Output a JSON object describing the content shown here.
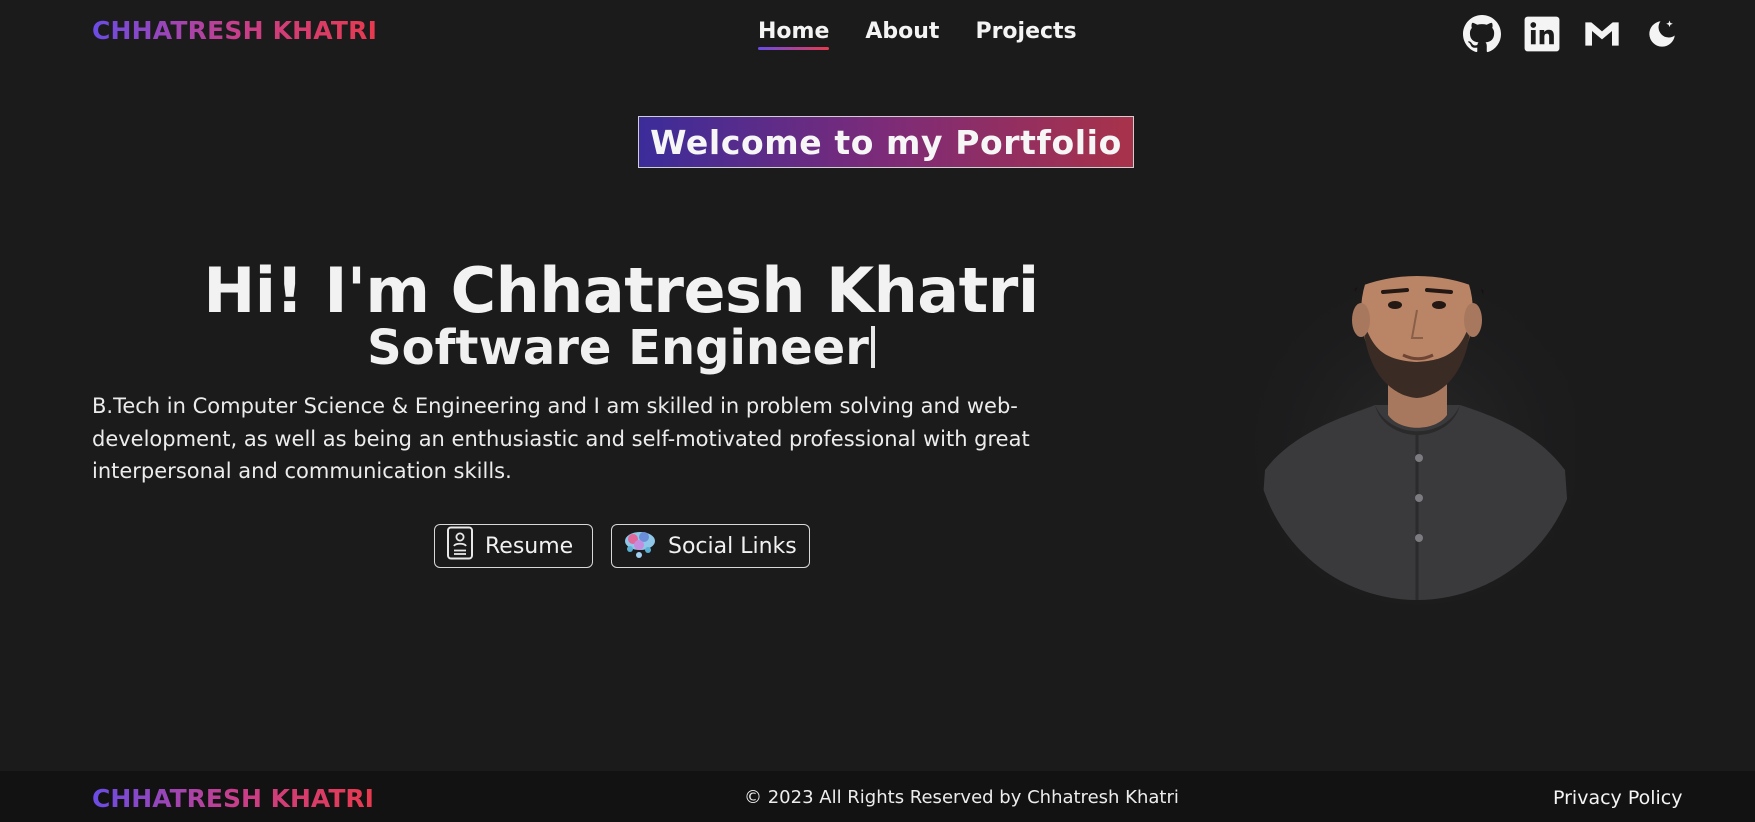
{
  "header": {
    "logo": "CHHATRESH KHATRI",
    "nav": [
      {
        "label": "Home",
        "active": true
      },
      {
        "label": "About",
        "active": false
      },
      {
        "label": "Projects",
        "active": false
      }
    ],
    "icons": [
      "github-icon",
      "linkedin-icon",
      "gmail-icon",
      "theme-toggle-moon-icon"
    ]
  },
  "hero": {
    "welcome": "Welcome to my Portfolio",
    "greeting": "Hi! I'm Chhatresh Khatri",
    "role": "Software Engineer",
    "bio": "B.Tech in Computer Science & Engineering and I am skilled in problem solving and web-development, as well as being an enthusiastic and self-motivated professional with great interpersonal and communication skills.",
    "buttons": {
      "resume": "Resume",
      "social": "Social Links"
    }
  },
  "footer": {
    "logo": "CHHATRESH KHATRI",
    "copyright": "© 2023 All Rights Reserved by Chhatresh Khatri",
    "privacy": "Privacy Policy"
  },
  "colors": {
    "background": "#1b1b1c",
    "footer_background": "#121212",
    "gradient_start": "#6a4ce6",
    "gradient_end": "#e83a4e"
  }
}
